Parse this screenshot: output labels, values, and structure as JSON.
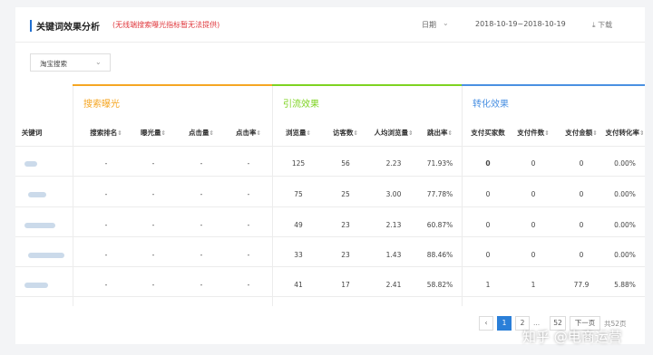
{
  "header": {
    "title": "关键词效果分析",
    "subtitle": "(无线端搜索曝光指标暂无法提供)",
    "date_label": "日期",
    "date_range": "2018-10-19~2018-10-19",
    "download_label": "下载"
  },
  "filter": {
    "selected": "淘宝搜索"
  },
  "groups": [
    {
      "label": "搜索曝光",
      "color": "#f5a623"
    },
    {
      "label": "引流效果",
      "color": "#7ed321"
    },
    {
      "label": "转化效果",
      "color": "#4a90e2"
    }
  ],
  "columns": [
    {
      "label": "关键词",
      "sortable": false
    },
    {
      "label": "搜索排名",
      "sortable": true
    },
    {
      "label": "曝光量",
      "sortable": true
    },
    {
      "label": "点击量",
      "sortable": true
    },
    {
      "label": "点击率",
      "sortable": true
    },
    {
      "label": "浏览量",
      "sortable": true
    },
    {
      "label": "访客数",
      "sortable": true
    },
    {
      "label": "人均浏览量",
      "sortable": true
    },
    {
      "label": "跳出率",
      "sortable": true
    },
    {
      "label": "支付买家数",
      "sortable": false
    },
    {
      "label": "支付件数",
      "sortable": true
    },
    {
      "label": "支付金额",
      "sortable": true
    },
    {
      "label": "支付转化率",
      "sortable": true
    }
  ],
  "sort_glyph": "⇕",
  "rows": [
    [
      "-",
      "-",
      "-",
      "-",
      "125",
      "56",
      "2.23",
      "71.93%",
      "0",
      "0",
      "0",
      "0.00%"
    ],
    [
      "-",
      "-",
      "-",
      "-",
      "75",
      "25",
      "3.00",
      "77.78%",
      "0",
      "0",
      "0",
      "0.00%"
    ],
    [
      "-",
      "-",
      "-",
      "-",
      "49",
      "23",
      "2.13",
      "60.87%",
      "0",
      "0",
      "0",
      "0.00%"
    ],
    [
      "-",
      "-",
      "-",
      "-",
      "33",
      "23",
      "1.43",
      "88.46%",
      "0",
      "0",
      "0",
      "0.00%"
    ],
    [
      "-",
      "-",
      "-",
      "-",
      "41",
      "17",
      "2.41",
      "58.82%",
      "1",
      "1",
      "77.9",
      "5.88%"
    ]
  ],
  "pagination": {
    "prev": "‹",
    "pages": [
      "1",
      "2"
    ],
    "ellipsis": "...",
    "last_page": "52",
    "next": "下一页",
    "total": "共52页",
    "current": "1"
  },
  "watermark": "知乎 @电商运营",
  "icons": {
    "dropdown": "chevron-down-icon",
    "download": "download-icon"
  }
}
